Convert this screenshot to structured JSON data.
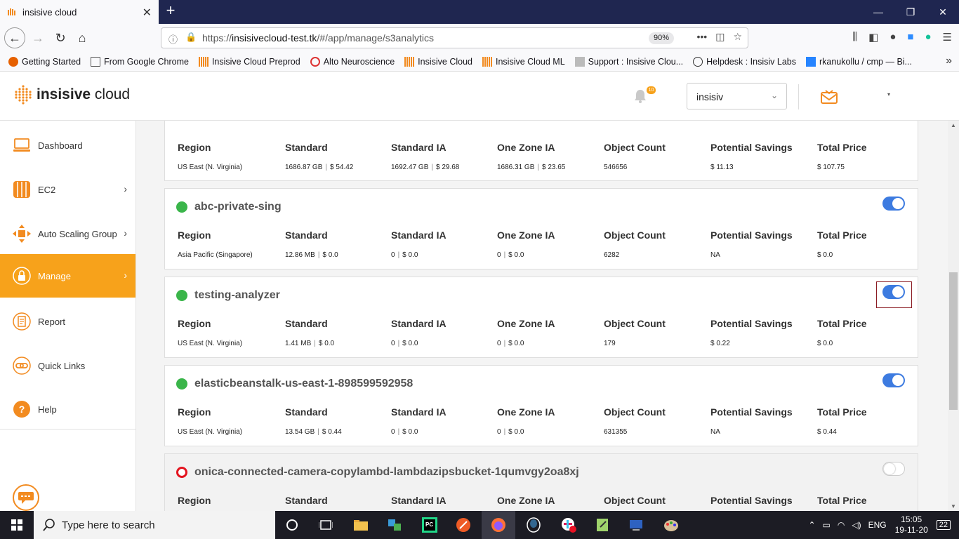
{
  "browser": {
    "tab_title": "insisive cloud",
    "url_prefix": "https://",
    "url_host": "insisivecloud-test.tk",
    "url_path": "/#/app/manage/s3analytics",
    "zoom": "90%"
  },
  "bookmarks": [
    {
      "label": "Getting Started"
    },
    {
      "label": "From Google Chrome"
    },
    {
      "label": "Insisive Cloud Preprod"
    },
    {
      "label": "Alto Neuroscience"
    },
    {
      "label": "Insisive Cloud"
    },
    {
      "label": "Insisive Cloud ML"
    },
    {
      "label": "Support : Insisive Clou..."
    },
    {
      "label": "Helpdesk : Insisiv Labs"
    },
    {
      "label": "rkanukollu / cmp — Bi..."
    }
  ],
  "header": {
    "logo_bold": "insisive",
    "logo_light": " cloud",
    "notification_count": "10",
    "account": "insisiv"
  },
  "sidebar": {
    "items": [
      {
        "label": "Dashboard"
      },
      {
        "label": "EC2"
      },
      {
        "label": "Auto Scaling Group"
      },
      {
        "label": "Manage"
      },
      {
        "label": "Report"
      },
      {
        "label": "Quick Links"
      },
      {
        "label": "Help"
      }
    ]
  },
  "columns": [
    "Region",
    "Standard",
    "Standard IA",
    "One Zone IA",
    "Object Count",
    "Potential Savings",
    "Total Price"
  ],
  "buckets": [
    {
      "name": "",
      "enabled": true,
      "region": "US East (N. Virginia)",
      "standard_size": "1686.87 GB",
      "standard_price": "$ 54.42",
      "ia_size": "1692.47 GB",
      "ia_price": "$ 29.68",
      "onezone_size": "1686.31 GB",
      "onezone_price": "$ 23.65",
      "object_count": "546656",
      "savings": "$ 11.13",
      "total": "$ 107.75"
    },
    {
      "name": "abc-private-sing",
      "enabled": true,
      "region": "Asia Pacific (Singapore)",
      "standard_size": "12.86 MB",
      "standard_price": "$ 0.0",
      "ia_size": "0",
      "ia_price": "$ 0.0",
      "onezone_size": "0",
      "onezone_price": "$ 0.0",
      "object_count": "6282",
      "savings": "NA",
      "total": "$ 0.0"
    },
    {
      "name": "testing-analyzer",
      "enabled": true,
      "region": "US East (N. Virginia)",
      "standard_size": "1.41 MB",
      "standard_price": "$ 0.0",
      "ia_size": "0",
      "ia_price": "$ 0.0",
      "onezone_size": "0",
      "onezone_price": "$ 0.0",
      "object_count": "179",
      "savings": "$ 0.22",
      "total": "$ 0.0"
    },
    {
      "name": "elasticbeanstalk-us-east-1-898599592958",
      "enabled": true,
      "region": "US East (N. Virginia)",
      "standard_size": "13.54 GB",
      "standard_price": "$ 0.44",
      "ia_size": "0",
      "ia_price": "$ 0.0",
      "onezone_size": "0",
      "onezone_price": "$ 0.0",
      "object_count": "631355",
      "savings": "NA",
      "total": "$ 0.44"
    },
    {
      "name": "onica-connected-camera-copylambd-lambdazipsbucket-1qumvgy2oa8xj",
      "enabled": false
    }
  ],
  "taskbar": {
    "search_placeholder": "Type here to search",
    "language": "ENG",
    "time": "15:05",
    "date": "19-11-20",
    "notification_count": "22"
  },
  "colors": {
    "accent": "#f7a21b",
    "toggle_on": "#3d7be0",
    "status_ok": "#3ab54a",
    "status_off": "#e3141f"
  }
}
